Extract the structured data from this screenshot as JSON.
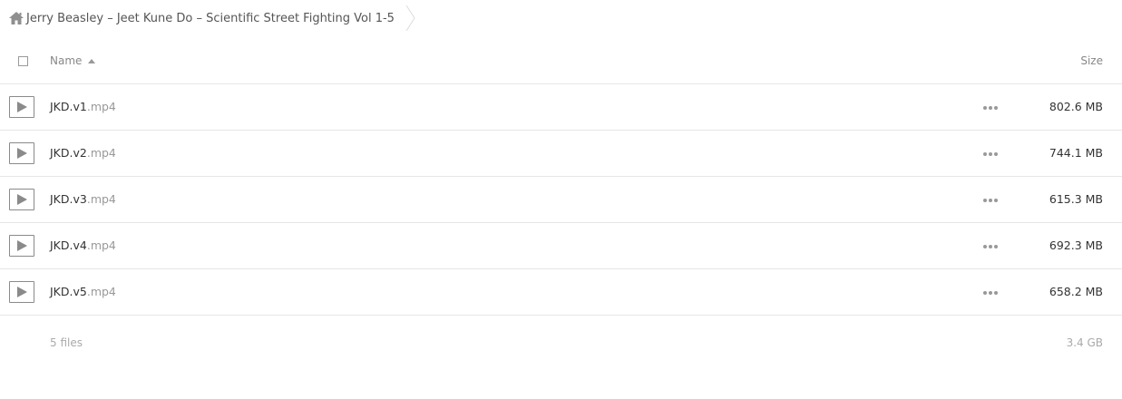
{
  "breadcrumb": {
    "home_icon": "home-icon",
    "folder": "Jerry Beasley – Jeet Kune Do – Scientific Street Fighting Vol 1-5"
  },
  "table": {
    "columns": {
      "name": "Name",
      "size": "Size"
    },
    "sort": "name-ascending",
    "rows": [
      {
        "base": "JKD.v1",
        "ext": ".mp4",
        "size": "802.6 MB",
        "icon": "play-icon"
      },
      {
        "base": "JKD.v2",
        "ext": ".mp4",
        "size": "744.1 MB",
        "icon": "play-icon"
      },
      {
        "base": "JKD.v3",
        "ext": ".mp4",
        "size": "615.3 MB",
        "icon": "play-icon"
      },
      {
        "base": "JKD.v4",
        "ext": ".mp4",
        "size": "692.3 MB",
        "icon": "play-icon"
      },
      {
        "base": "JKD.v5",
        "ext": ".mp4",
        "size": "658.2 MB",
        "icon": "play-icon"
      }
    ]
  },
  "footer": {
    "count": "5 files",
    "total": "3.4 GB"
  },
  "colors": {
    "text": "#333333",
    "muted": "#999999",
    "border": "#e6e6e6"
  }
}
